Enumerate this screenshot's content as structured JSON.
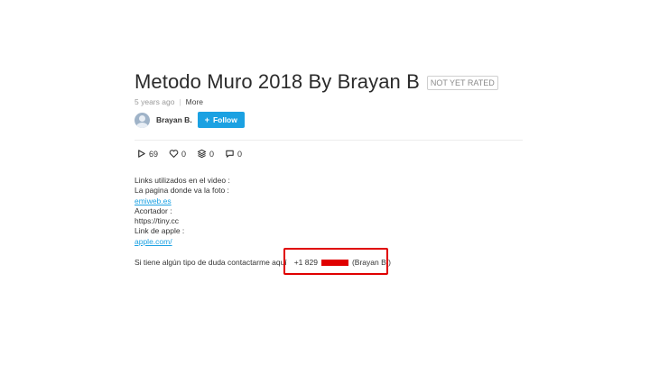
{
  "video": {
    "title": "Metodo Muro 2018 By Brayan B",
    "rating_badge": "NOT YET RATED",
    "age": "5 years ago",
    "more_label": "More"
  },
  "author": {
    "name": "Brayan B.",
    "follow_label": "Follow"
  },
  "stats": {
    "plays": "69",
    "likes": "0",
    "collections": "0",
    "comments": "0"
  },
  "description": {
    "lines": [
      "Links utilizados en el video :",
      "La pagina donde va la foto :",
      "emiweb.es",
      "Acortador :",
      "https://tiny.cc",
      "Link de apple :",
      "apple.com/"
    ],
    "contact_text": "Si tiene algún tipo de duda contactarme aquí",
    "phone_prefix": "+1 829",
    "phone_suffix": "(Brayan B.)"
  },
  "colors": {
    "accent": "#1ba1e2",
    "highlight": "#e00000"
  }
}
